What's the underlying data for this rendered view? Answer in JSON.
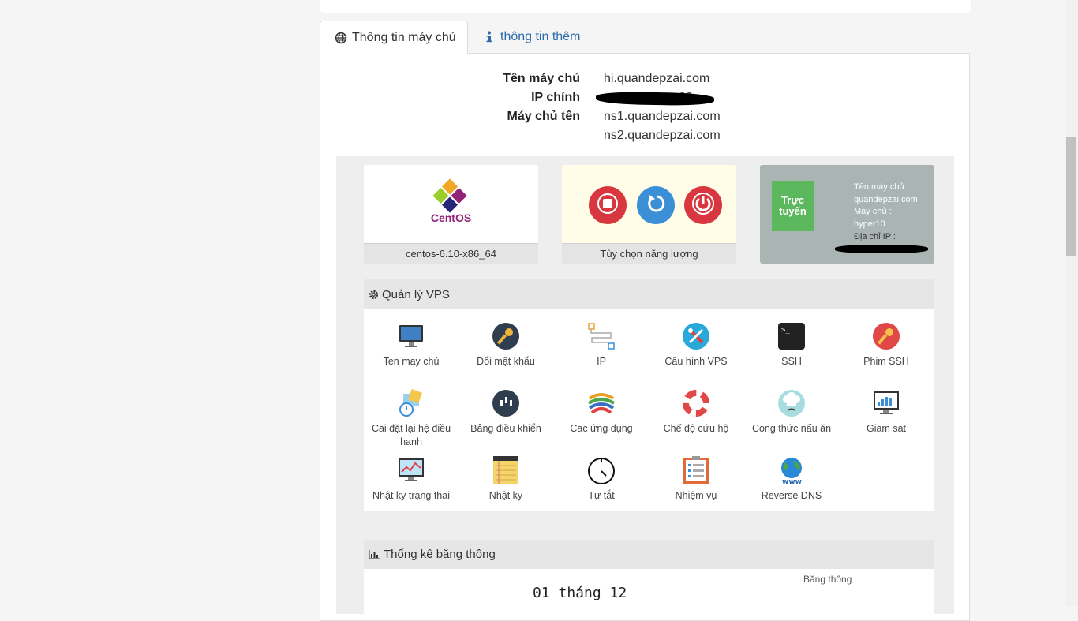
{
  "tabs": [
    {
      "label": "Thông tin máy chủ",
      "icon": "globe-icon",
      "active": true
    },
    {
      "label": "thông tin thêm",
      "icon": "info-icon",
      "active": false
    }
  ],
  "server_info": {
    "hostname_label": "Tên máy chủ",
    "hostname": "hi.quandepzai.com",
    "ip_label": "IP chính",
    "ip_visible_fragment": "20",
    "ns_label": "Máy chủ tên",
    "ns1": "ns1.quandepzai.com",
    "ns2": "ns2.quandepzai.com"
  },
  "os_card": {
    "logo_text": "CentOS",
    "label": "centos-6.10-x86_64"
  },
  "power_card": {
    "label": "Tùy chọn năng lượng",
    "buttons": [
      "stop-icon",
      "restart-icon",
      "power-icon"
    ]
  },
  "status_card": {
    "status": "Trực tuyến",
    "lines": [
      "Tên máy chủ:",
      "quandepzai.com",
      "Máy chủ :",
      "hyper10",
      "Địa chỉ IP :"
    ]
  },
  "management": {
    "title": "Quản lý VPS",
    "items": [
      {
        "label": "Ten may chủ",
        "icon": "monitor-icon"
      },
      {
        "label": "Đổi mật khẩu",
        "icon": "key-icon"
      },
      {
        "label": "IP",
        "icon": "network-icon"
      },
      {
        "label": "Cấu hình VPS",
        "icon": "tools-icon"
      },
      {
        "label": "SSH",
        "icon": "terminal-icon"
      },
      {
        "label": "Phim SSH",
        "icon": "ssh-key-icon"
      },
      {
        "label": "Cai đặt lại hệ điều hanh",
        "icon": "reinstall-icon"
      },
      {
        "label": "Bảng điều khiển",
        "icon": "control-panel-icon"
      },
      {
        "label": "Cac ứng dụng",
        "icon": "apps-icon"
      },
      {
        "label": "Chế độ cứu hộ",
        "icon": "lifebuoy-icon"
      },
      {
        "label": "Cong thức nấu ăn",
        "icon": "chef-icon"
      },
      {
        "label": "Giam sat",
        "icon": "monitoring-icon"
      },
      {
        "label": "Nhật ky trạng thai",
        "icon": "status-log-icon"
      },
      {
        "label": "Nhật ky",
        "icon": "notepad-icon"
      },
      {
        "label": "Tự tắt",
        "icon": "timer-icon"
      },
      {
        "label": "Nhiệm vụ",
        "icon": "task-list-icon"
      },
      {
        "label": "Reverse DNS",
        "icon": "globe-www-icon"
      }
    ]
  },
  "bandwidth": {
    "title": "Thống kê băng thông",
    "date": "01 tháng 12",
    "legend": "Băng thông"
  },
  "colors": {
    "accent_blue": "#2d6aa9",
    "online_green": "#5cb85c",
    "power_red": "#d9373f",
    "restart_blue": "#3a8fd6"
  }
}
